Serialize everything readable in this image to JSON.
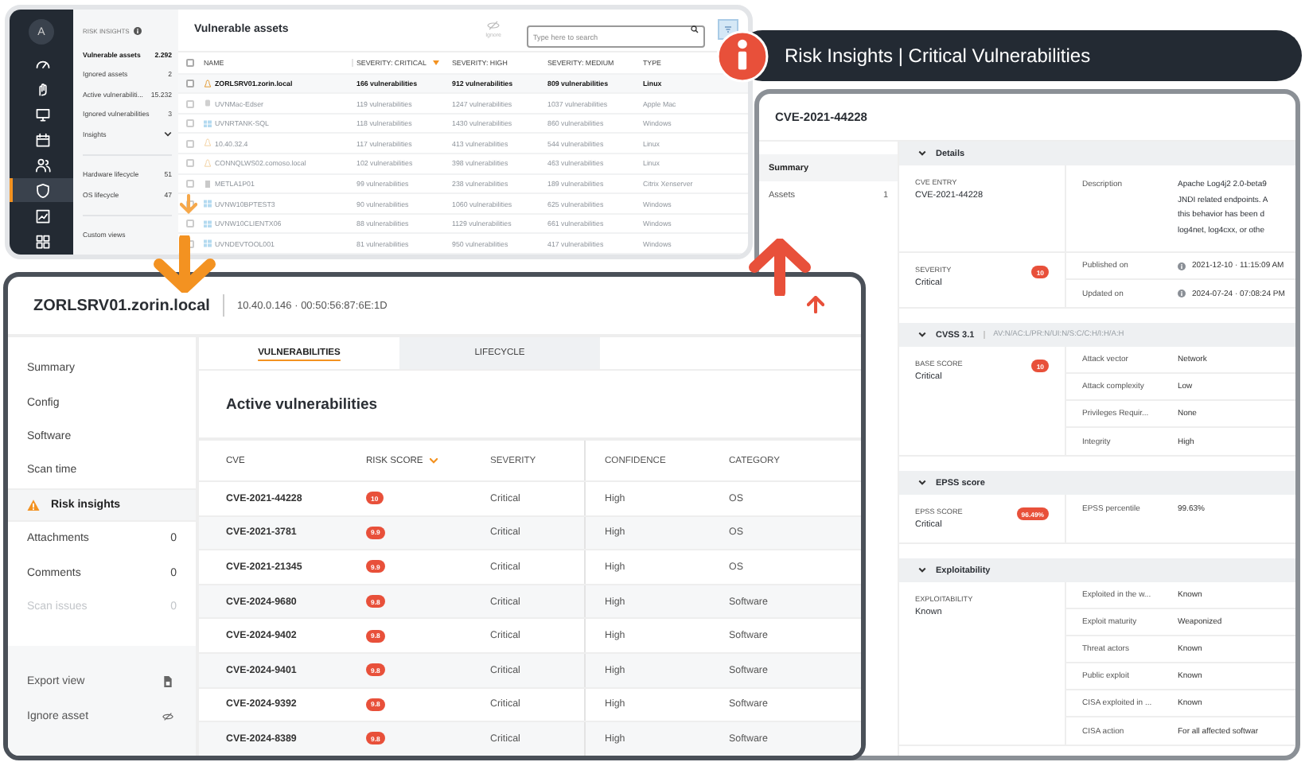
{
  "overview": {
    "avatar": "A",
    "rail": [
      {
        "kind": "gauge",
        "selected": false
      },
      {
        "kind": "hand",
        "selected": false
      },
      {
        "kind": "monitor",
        "selected": false
      },
      {
        "kind": "calendar",
        "selected": false
      },
      {
        "kind": "users",
        "selected": false
      },
      {
        "kind": "shield",
        "selected": true
      },
      {
        "kind": "chart",
        "selected": false
      },
      {
        "kind": "grid",
        "selected": false
      }
    ],
    "sidebar_title": "RISK INSIGHTS",
    "groups": [
      {
        "items": [
          {
            "label": "Vulnerable assets",
            "count": "2.292",
            "selected": true,
            "expandable": false
          },
          {
            "label": "Ignored assets",
            "count": "2",
            "selected": false,
            "expandable": false
          },
          {
            "label": "Active vulnerabiliti...",
            "count": "15.232",
            "selected": false,
            "expandable": false
          },
          {
            "label": "Ignored vulnerabilities",
            "count": "3",
            "selected": false,
            "expandable": false
          },
          {
            "label": "Insights",
            "selected": false,
            "expandable": true
          }
        ]
      },
      {
        "items": [
          {
            "label": "Hardware lifecycle",
            "count": "51",
            "selected": false,
            "expandable": false
          },
          {
            "label": "OS lifecycle",
            "count": "47",
            "selected": false,
            "expandable": false
          }
        ]
      },
      {
        "items": [
          {
            "label": "Custom views",
            "selected": false,
            "expandable": false
          }
        ]
      }
    ],
    "title": "Vulnerable assets",
    "ignore_label": "Ignore",
    "search": {
      "placeholder": "Type here to search"
    },
    "all_checked": false,
    "columns": [
      {
        "label": "NAME",
        "sorted": false
      },
      {
        "label": "SEVERITY: CRITICAL",
        "sorted": true
      },
      {
        "label": "SEVERITY: HIGH",
        "sorted": false
      },
      {
        "label": "SEVERITY: MEDIUM",
        "sorted": false
      },
      {
        "label": "TYPE",
        "sorted": false
      }
    ],
    "rows": [
      {
        "kind": "linux",
        "checked": false,
        "name": "ZORLSRV01.zorin.local",
        "critical": "166 vulnerabilities",
        "high": "912 vulnerabilities",
        "medium": "809 vulnerabilities",
        "type": "Linux",
        "faded": false
      },
      {
        "kind": "apple",
        "checked": false,
        "name": "UVNMac-Edser",
        "critical": "119 vulnerabilities",
        "high": "1247 vulnerabilities",
        "medium": "1037 vulnerabilities",
        "type": "Apple Mac",
        "faded": true
      },
      {
        "kind": "windows",
        "checked": false,
        "name": "UVNRTANK-SQL",
        "critical": "118 vulnerabilities",
        "high": "1430 vulnerabilities",
        "medium": "860 vulnerabilities",
        "type": "Windows",
        "faded": true
      },
      {
        "kind": "linux",
        "checked": false,
        "name": "10.40.32.4",
        "critical": "117 vulnerabilities",
        "high": "413 vulnerabilities",
        "medium": "544 vulnerabilities",
        "type": "Linux",
        "faded": true
      },
      {
        "kind": "linux",
        "checked": false,
        "name": "CONNQLWS02.comoso.local",
        "critical": "102 vulnerabilities",
        "high": "398 vulnerabilities",
        "medium": "463 vulnerabilities",
        "type": "Linux",
        "faded": true
      },
      {
        "kind": "server",
        "checked": false,
        "name": "METLA1P01",
        "critical": "99 vulnerabilities",
        "high": "238 vulnerabilities",
        "medium": "189 vulnerabilities",
        "type": "Citrix Xenserver",
        "faded": true
      },
      {
        "kind": "windows",
        "checked": false,
        "name": "UVNW10BPTEST3",
        "critical": "90 vulnerabilities",
        "high": "1060 vulnerabilities",
        "medium": "625 vulnerabilities",
        "type": "Windows",
        "faded": true
      },
      {
        "kind": "windows",
        "checked": false,
        "name": "UVNW10CLIENTX06",
        "critical": "88 vulnerabilities",
        "high": "1129 vulnerabilities",
        "medium": "661 vulnerabilities",
        "type": "Windows",
        "faded": true
      },
      {
        "kind": "windows",
        "checked": false,
        "name": "UVNDEVTOOL001",
        "critical": "81 vulnerabilities",
        "high": "950 vulnerabilities",
        "medium": "417 vulnerabilities",
        "type": "Windows",
        "faded": true
      }
    ]
  },
  "banner": {
    "title": "Risk Insights | Critical Vulnerabilities"
  },
  "cve": {
    "title": "CVE-2021-44228",
    "nav": [
      {
        "label": "Summary",
        "selected": true
      },
      {
        "label": "Assets",
        "count": "1",
        "selected": false
      }
    ],
    "sections": [
      {
        "kind": "details",
        "title": "Details",
        "entry": {
          "label": "CVE ENTRY",
          "value": "CVE-2021-44228"
        },
        "description": {
          "label": "Description",
          "lines": [
            "Apache Log4j2 2.0-beta9",
            "JNDI related endpoints. A",
            "this behavior has been d",
            "log4net, log4cxx, or othe"
          ]
        },
        "severity": {
          "label": "SEVERITY",
          "value": "Critical",
          "badge": "10"
        },
        "dates": [
          {
            "label": "Published on",
            "value": "2021-12-10 · 11:15:09 AM"
          },
          {
            "label": "Updated on",
            "value": "2024-07-24 · 07:08:24 PM"
          }
        ]
      },
      {
        "kind": "metrics",
        "title": "CVSS 3.1",
        "vector": "AV:N/AC:L/PR:N/UI:N/S:C/C:H/I:H/A:H",
        "summary": {
          "label": "BASE SCORE",
          "value": "Critical",
          "badge": "10"
        },
        "fields": [
          {
            "label": "Attack vector",
            "value": "Network"
          },
          {
            "label": "Attack complexity",
            "value": "Low"
          },
          {
            "label": "Privileges Requir...",
            "value": "None"
          },
          {
            "label": "Integrity",
            "value": "High"
          }
        ]
      },
      {
        "kind": "metrics",
        "title": "EPSS score",
        "summary": {
          "label": "EPSS SCORE",
          "value": "Critical",
          "badge": "96.49%"
        },
        "fields": [
          {
            "label": "EPSS percentile",
            "value": "99.63%"
          }
        ]
      },
      {
        "kind": "metrics",
        "title": "Exploitability",
        "summary": {
          "label": "EXPLOITABILITY",
          "value": "Known"
        },
        "fields": [
          {
            "label": "Exploited in the w...",
            "value": "Known"
          },
          {
            "label": "Exploit maturity",
            "value": "Weaponized"
          },
          {
            "label": "Threat actors",
            "value": "Known"
          },
          {
            "label": "Public exploit",
            "value": "Known"
          },
          {
            "label": "CISA exploited in ...",
            "value": "Known"
          },
          {
            "label": "CISA action",
            "value": "For all affected softwar"
          }
        ]
      }
    ]
  },
  "asset": {
    "title": "ZORLSRV01.zorin.local",
    "address": "10.40.0.146 · 00:50:56:87:6E:1D",
    "nav": [
      {
        "label": "Summary",
        "selected": false,
        "disabled": false,
        "warning": false
      },
      {
        "label": "Config",
        "selected": false,
        "disabled": false,
        "warning": false
      },
      {
        "label": "Software",
        "selected": false,
        "disabled": false,
        "warning": false
      },
      {
        "label": "Scan time",
        "selected": false,
        "disabled": false,
        "warning": false
      },
      {
        "label": "Risk insights",
        "selected": true,
        "disabled": false,
        "warning": true
      },
      {
        "label": "Attachments",
        "count": "0",
        "selected": false,
        "disabled": false,
        "warning": false
      },
      {
        "label": "Comments",
        "count": "0",
        "selected": false,
        "disabled": false,
        "warning": false
      },
      {
        "label": "Scan issues",
        "count": "0",
        "selected": false,
        "disabled": true,
        "warning": false
      }
    ],
    "actions": [
      {
        "kind": "export",
        "label": "Export view"
      },
      {
        "kind": "ignore",
        "label": "Ignore asset"
      }
    ],
    "tabs": [
      {
        "label": "VULNERABILITIES",
        "selected": true
      },
      {
        "label": "LIFECYCLE",
        "selected": false
      }
    ],
    "section_title": "Active vulnerabilities",
    "columns": [
      {
        "label": "CVE",
        "sorted": false
      },
      {
        "label": "RISK SCORE",
        "sorted": true
      },
      {
        "label": "SEVERITY",
        "sorted": false
      },
      {
        "label": "CONFIDENCE",
        "sorted": false
      },
      {
        "label": "CATEGORY",
        "sorted": false
      }
    ],
    "rows": [
      {
        "cve": "CVE-2021-44228",
        "score": "10",
        "severity": "Critical",
        "confidence": "High",
        "category": "OS"
      },
      {
        "cve": "CVE-2021-3781",
        "score": "9.9",
        "severity": "Critical",
        "confidence": "High",
        "category": "OS"
      },
      {
        "cve": "CVE-2021-21345",
        "score": "9.9",
        "severity": "Critical",
        "confidence": "High",
        "category": "OS"
      },
      {
        "cve": "CVE-2024-9680",
        "score": "9.8",
        "severity": "Critical",
        "confidence": "High",
        "category": "Software"
      },
      {
        "cve": "CVE-2024-9402",
        "score": "9.8",
        "severity": "Critical",
        "confidence": "High",
        "category": "Software"
      },
      {
        "cve": "CVE-2024-9401",
        "score": "9.8",
        "severity": "Critical",
        "confidence": "High",
        "category": "Software"
      },
      {
        "cve": "CVE-2024-9392",
        "score": "9.8",
        "severity": "Critical",
        "confidence": "High",
        "category": "Software"
      },
      {
        "cve": "CVE-2024-8389",
        "score": "9.8",
        "severity": "Critical",
        "confidence": "High",
        "category": "Software"
      }
    ]
  }
}
